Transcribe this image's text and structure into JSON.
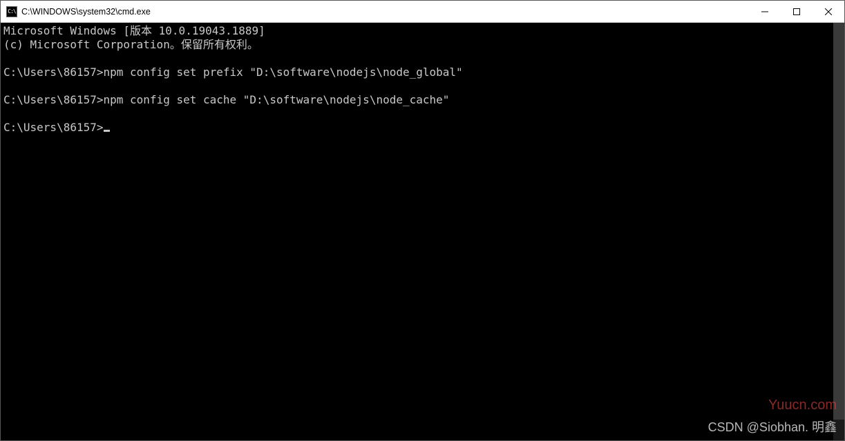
{
  "titlebar": {
    "icon_label": "C:\\",
    "title": "C:\\WINDOWS\\system32\\cmd.exe"
  },
  "window_controls": {
    "minimize": "—",
    "maximize": "▢",
    "close": "✕"
  },
  "terminal": {
    "line1": "Microsoft Windows [版本 10.0.19043.1889]",
    "line2": "(c) Microsoft Corporation。保留所有权利。",
    "blank": "",
    "prompt1": "C:\\Users\\86157>",
    "cmd1": "npm config set prefix \"D:\\software\\nodejs\\node_global\"",
    "prompt2": "C:\\Users\\86157>",
    "cmd2": "npm config set cache \"D:\\software\\nodejs\\node_cache\"",
    "prompt3": "C:\\Users\\86157>"
  },
  "watermarks": {
    "red": "Yuucn.com",
    "gray": "CSDN @Siobhan. 明鑫"
  }
}
